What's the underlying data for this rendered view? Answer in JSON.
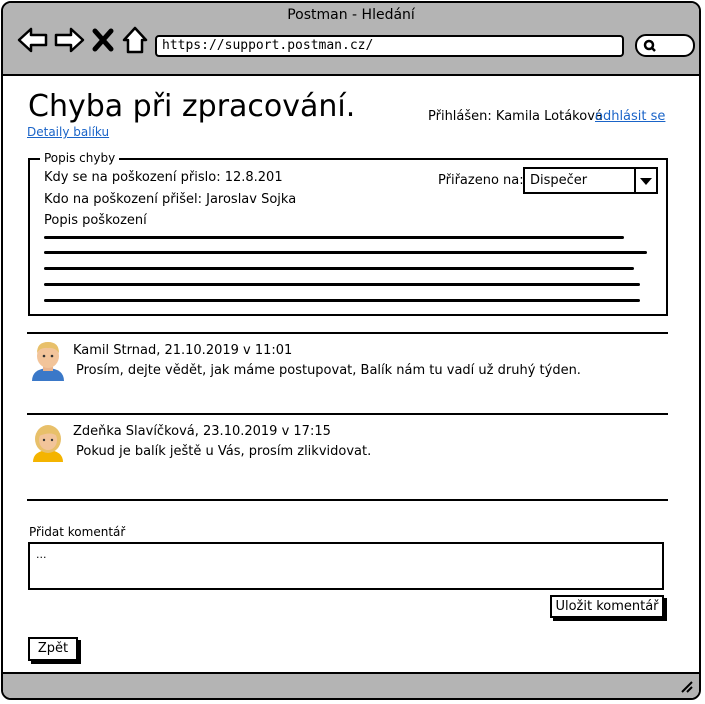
{
  "browser": {
    "title": "Postman - Hledání",
    "url": "https://support.postman.cz/",
    "icons": [
      "back-icon",
      "forward-icon",
      "close-icon",
      "home-icon",
      "search-icon"
    ]
  },
  "header": {
    "page_title": "Chyba při zpracování.",
    "details_link": "Detaily balíku",
    "logged_in_label": "Přihlášen: Kamila Lotáková",
    "logout_link": "odhlásit se"
  },
  "error": {
    "legend": "Popis chyby",
    "when_text": "Kdy se na poškození přislo: 12.8.201",
    "who_text": "Kdo na poškození přišel: Jaroslav Sojka",
    "desc_label": "Popis poškození",
    "assigned_label": "Přiřazeno na:",
    "assigned_value": "Dispečer"
  },
  "comments": [
    {
      "author": "Kamil Strnad, 21.10.2019 v 11:01",
      "text": "Prosím, dejte vědět, jak máme postupovat, Balík nám tu vadí už druhý týden.",
      "avatar": "man-avatar-icon"
    },
    {
      "author": "Zdeňka Slavíčková, 23.10.2019 v 17:15",
      "text": "Pokud je balík ještě u Vás, prosím zlikvidovat.",
      "avatar": "woman-avatar-icon"
    }
  ],
  "add_comment": {
    "label": "Přidat komentář",
    "placeholder": "...",
    "save_button": "Uložit komentář"
  },
  "back_button": "Zpět"
}
